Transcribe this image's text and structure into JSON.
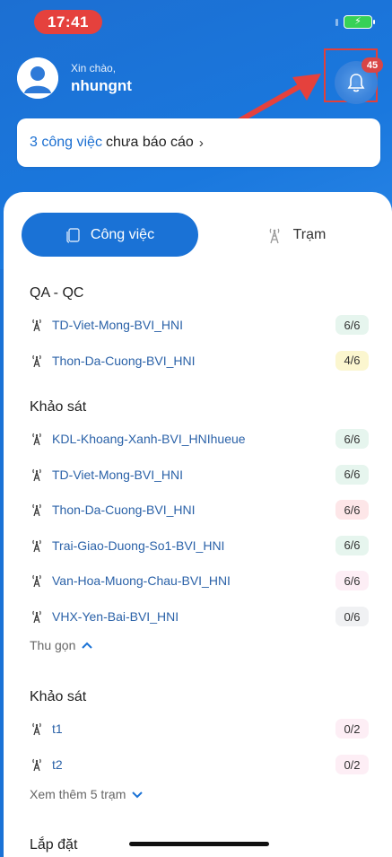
{
  "status_bar": {
    "time": "17:41",
    "battery_icon": "battery-charging-icon"
  },
  "header": {
    "greeting": "Xin chào,",
    "username": "nhungnt",
    "notification_count": "45"
  },
  "task_card": {
    "count_text": "3 công việc",
    "rest_text": "chưa báo cáo",
    "chevron": "›"
  },
  "tabs": {
    "active": {
      "label": "Công việc",
      "icon": "document-icon"
    },
    "inactive": {
      "label": "Trạm",
      "icon": "tower-icon"
    }
  },
  "badge_colors": {
    "green": "#e6f5ee",
    "yellow": "#fbf6cf",
    "red": "#fde6e8",
    "pink": "#fdeef5",
    "grey": "#f0f1f3"
  },
  "sections": [
    {
      "title": "QA - QC",
      "rows": [
        {
          "name": "TD-Viet-Mong-BVI_HNI",
          "badge": "6/6",
          "color": "green"
        },
        {
          "name": "Thon-Da-Cuong-BVI_HNI",
          "badge": "4/6",
          "color": "yellow"
        }
      ]
    },
    {
      "title": "Khảo sát",
      "rows": [
        {
          "name": "KDL-Khoang-Xanh-BVI_HNIhueue",
          "badge": "6/6",
          "color": "green"
        },
        {
          "name": "TD-Viet-Mong-BVI_HNI",
          "badge": "6/6",
          "color": "green"
        },
        {
          "name": "Thon-Da-Cuong-BVI_HNI",
          "badge": "6/6",
          "color": "red"
        },
        {
          "name": "Trai-Giao-Duong-So1-BVI_HNI",
          "badge": "6/6",
          "color": "green"
        },
        {
          "name": "Van-Hoa-Muong-Chau-BVI_HNI",
          "badge": "6/6",
          "color": "pink"
        },
        {
          "name": "VHX-Yen-Bai-BVI_HNI",
          "badge": "0/6",
          "color": "grey"
        }
      ],
      "link": "Thu gọn"
    },
    {
      "title": "Khảo sát",
      "rows": [
        {
          "name": "t1",
          "badge": "0/2",
          "color": "pink"
        },
        {
          "name": "t2",
          "badge": "0/2",
          "color": "pink"
        }
      ],
      "link": "Xem thêm 5 trạm"
    },
    {
      "title": "Lắp đặt",
      "rows": []
    }
  ]
}
